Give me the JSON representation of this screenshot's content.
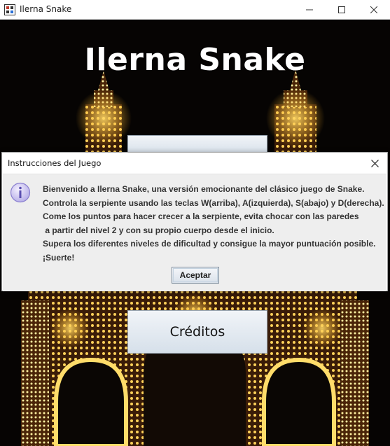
{
  "window": {
    "title": "Ilerna Snake",
    "icons": [
      "app-icon",
      "minimize-icon",
      "maximize-icon",
      "close-icon"
    ]
  },
  "game": {
    "title": "Ilerna Snake",
    "menu": {
      "top_button_label": "",
      "credits_label": "Créditos"
    }
  },
  "dialog": {
    "title": "Instrucciones del Juego",
    "icon": "info-icon",
    "lines": [
      "Bienvenido a Ilerna Snake, una versión emocionante del clásico juego de Snake.",
      "Controla la serpiente usando las teclas W(arriba), A(izquierda), S(abajo) y D(derecha).",
      "Come los puntos para hacer crecer a la serpiente, evita chocar con las paredes",
      " a partir del nivel 2 y con su propio cuerpo desde el inicio.",
      "Supera los diferentes niveles de dificultad y consigue la mayor puntuación posible.",
      "¡Suerte!"
    ],
    "accept_label": "Aceptar"
  },
  "colors": {
    "lights": "#f5c842",
    "dialog_body": "#eeeeee",
    "info_icon": "#8a7fd0"
  }
}
